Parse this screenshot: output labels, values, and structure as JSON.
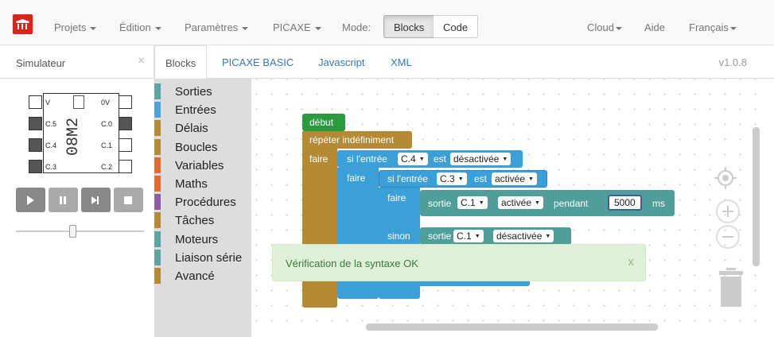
{
  "colors": {
    "accent": "#d9251c",
    "link": "#337ab7",
    "toast_bg": "#dff0d8",
    "toast_text": "#3c763d"
  },
  "navbar": {
    "logo_icon": "picaxe-logo-icon",
    "menus": [
      {
        "label": "Projets"
      },
      {
        "label": "Édition"
      },
      {
        "label": "Paramètres"
      },
      {
        "label": "PICAXE"
      }
    ],
    "mode_label": "Mode:",
    "mode_blocks": "Blocks",
    "mode_code": "Code",
    "cloud": "Cloud",
    "help": "Aide",
    "language": "Français"
  },
  "simulator": {
    "title": "Simulateur",
    "close_icon": "close-icon",
    "chip_name": "08M2",
    "pins_left": [
      "V",
      "C.5",
      "C.4",
      "C.3"
    ],
    "pins_right": [
      "0V",
      "C.0",
      "C.1",
      "C.2"
    ],
    "controls": [
      "play-icon",
      "pause-icon",
      "step-icon",
      "stop-icon"
    ],
    "speed_level": 0.5
  },
  "tabs": {
    "blocks": "Blocks",
    "basic": "PICAXE BASIC",
    "javascript": "Javascript",
    "xml": "XML",
    "version": "v1.0.8"
  },
  "toolbox": [
    {
      "label": "Sorties",
      "color": "#5ba5a5"
    },
    {
      "label": "Entrées",
      "color": "#4fa4d9"
    },
    {
      "label": "Délais",
      "color": "#b58a35"
    },
    {
      "label": "Boucles",
      "color": "#b58a35"
    },
    {
      "label": "Variables",
      "color": "#e36b2f"
    },
    {
      "label": "Maths",
      "color": "#e36b2f"
    },
    {
      "label": "Procédures",
      "color": "#8f5aa6"
    },
    {
      "label": "Tâches",
      "color": "#b58a35"
    },
    {
      "label": "Moteurs",
      "color": "#5ba5a5"
    },
    {
      "label": "Liaison série",
      "color": "#5ba5a5"
    },
    {
      "label": "Avancé",
      "color": "#b58a35"
    }
  ],
  "blocks": {
    "start": "début",
    "repeat": "répéter indéfiniment",
    "do": "faire",
    "if_input": "si l'entrée",
    "is": "est",
    "pin_c4": "C.4",
    "state_off": "désactivée",
    "pin_c3": "C.3",
    "state_on": "activée",
    "output": "sortie",
    "pin_c1": "C.1",
    "for": "pendant",
    "duration": "5000",
    "unit": "ms",
    "else": "sinon"
  },
  "toast": {
    "message": "Vérification de la syntaxe OK",
    "close": "x"
  },
  "workspace_icons": [
    "center-icon",
    "zoom-in-icon",
    "zoom-out-icon",
    "trash-icon"
  ]
}
